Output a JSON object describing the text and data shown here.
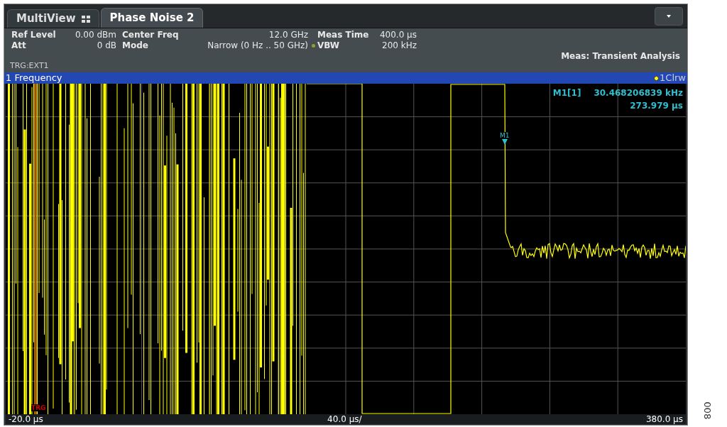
{
  "tabs": [
    {
      "label": "MultiView",
      "selected": false,
      "kind": "overview"
    },
    {
      "label": "Phase Noise 2",
      "selected": true,
      "kind": "channel"
    }
  ],
  "settings": [
    [
      {
        "label": "Ref Level",
        "value": "0.00 dBm"
      },
      {
        "label": "Att",
        "value": "0 dB"
      }
    ],
    [
      {
        "label": "Center Freq",
        "value": "12.0 GHz"
      },
      {
        "label": "Mode",
        "value": "Narrow (0 Hz .. 50 GHz)"
      }
    ],
    [
      {
        "label": "Meas Time",
        "value": "400.0 µs"
      },
      {
        "label": "VBW",
        "value": "200 kHz"
      }
    ]
  ],
  "measurement": "Meas: Transient Analysis",
  "trigger": "TRG:EXT1",
  "window": {
    "title": "1 Frequency",
    "trace": "1Clrw"
  },
  "marker": {
    "name": "M1[1]",
    "value": "30.468206839 kHz",
    "time": "273.979 µs",
    "label": "M1"
  },
  "trigger_mark": "TRG",
  "x_axis": {
    "start": "-20.0 µs",
    "division": "40.0 µs/",
    "stop": "380.0 µs"
  },
  "figure_number": "008"
}
